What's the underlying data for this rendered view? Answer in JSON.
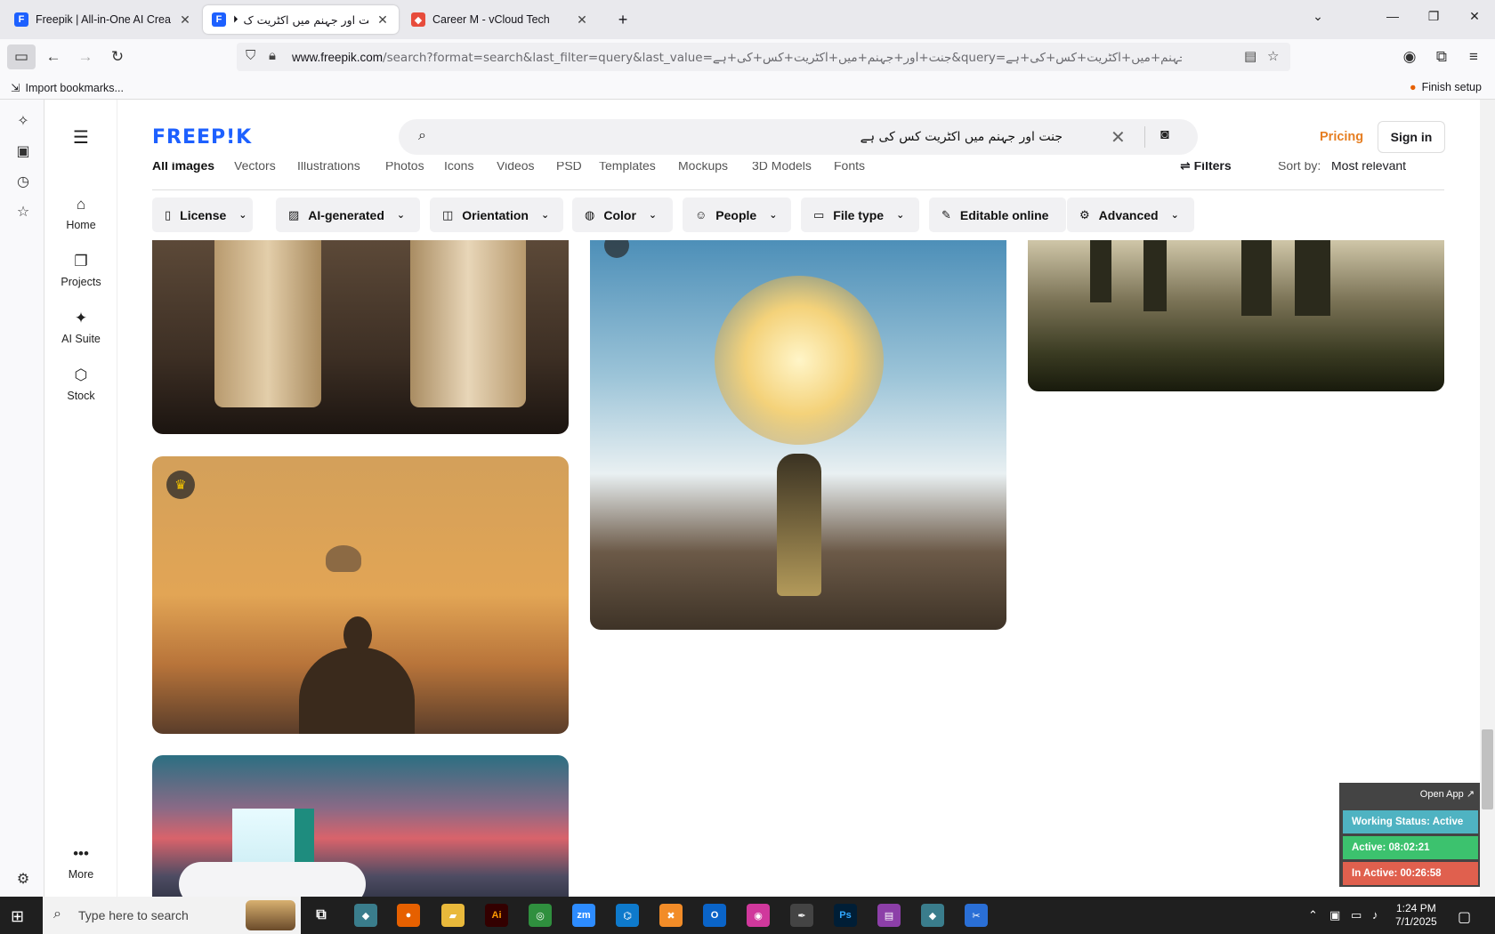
{
  "browser": {
    "tabs": [
      {
        "title": "Freepik | All-in-One AI Creative",
        "favicon": "F"
      },
      {
        "title": "جنت اور جہنم میں اکٹریت ک",
        "favicon": "F"
      },
      {
        "title": "Career M - vCloud Tech",
        "favicon": "◆"
      }
    ],
    "url_host": "www.freepik.com",
    "url_path": "/search?format=search&last_filter=query&last_value=جنت+اور+جہنم+میں+اکٹریت+کس+کی+ہے&query=جنت+اور+جہنم+میں+اکٹریت+کس+کی+ہے",
    "bookmark_import": "Import bookmarks...",
    "finish_setup": "Finish setup"
  },
  "freepik": {
    "logo": "FREEP!K",
    "nav": [
      {
        "label": "Home"
      },
      {
        "label": "Projects"
      },
      {
        "label": "AI Suite"
      },
      {
        "label": "Stock"
      }
    ],
    "more_label": "More",
    "search_value": "جنت اور جہنم میں اکٹریت کس کی ہے",
    "pricing": "Pricing",
    "signin": "Sign in",
    "category_tabs": [
      "All images",
      "Vectors",
      "Illustrations",
      "Photos",
      "Icons",
      "Videos",
      "PSD",
      "Templates",
      "Mockups",
      "3D Models",
      "Fonts"
    ],
    "filters_label": "Filters",
    "sort_label": "Sort by:",
    "sort_value": "Most relevant",
    "filter_pills": [
      {
        "label": "License",
        "icon": "license-icon"
      },
      {
        "label": "AI-generated",
        "icon": "ai-icon"
      },
      {
        "label": "Orientation",
        "icon": "orientation-icon"
      },
      {
        "label": "Color",
        "icon": "palette-icon"
      },
      {
        "label": "People",
        "icon": "people-icon"
      },
      {
        "label": "File type",
        "icon": "file-icon"
      },
      {
        "label": "Editable online",
        "icon": "pen-icon"
      },
      {
        "label": "Advanced",
        "icon": "gear-icon"
      }
    ]
  },
  "widget": {
    "open_app": "Open App ↗",
    "status": "Working Status: Active",
    "active": "Active: 08:02:21",
    "inactive": "In Active: 00:26:58",
    "colors": {
      "status": "#4fb3c2",
      "active": "#3cc26e",
      "inactive": "#e0604e"
    }
  },
  "taskbar": {
    "search_placeholder": "Type here to search",
    "time": "1:24 PM",
    "date": "7/1/2025"
  }
}
